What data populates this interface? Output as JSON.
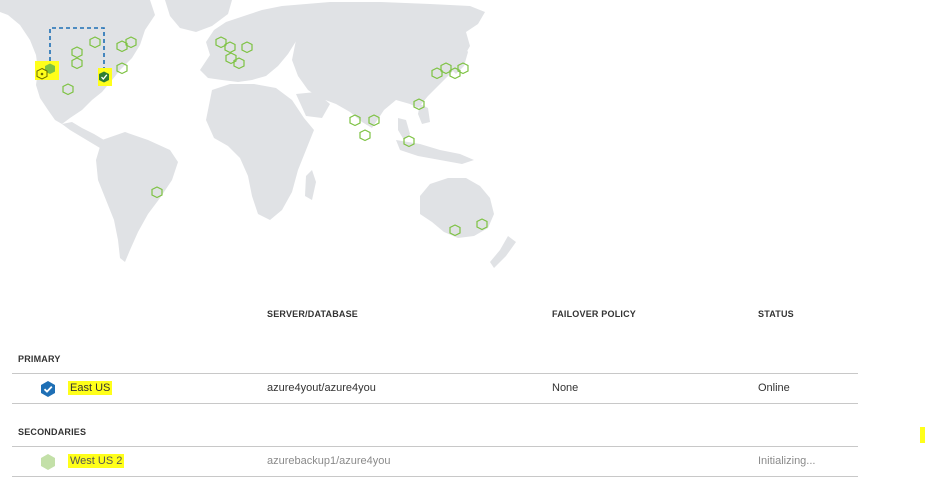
{
  "columns": {
    "server_database": "SERVER/DATABASE",
    "failover_policy": "FAILOVER POLICY",
    "status": "STATUS"
  },
  "primary": {
    "section_label": "PRIMARY",
    "region": "East US",
    "server_database": "azure4yout/azure4you",
    "failover_policy": "None",
    "status": "Online"
  },
  "secondaries": {
    "section_label": "SECONDARIES",
    "region": "West US 2",
    "server_database": "azurebackup1/azure4you",
    "failover_policy": "",
    "status": "Initializing..."
  },
  "colors": {
    "land": "#e0e2e5",
    "region_marker": "#7dc242",
    "primary_icon": "#1e6fb5",
    "secondary_icon": "#c3e0a8",
    "highlight": "#ffff1a",
    "link_line": "#1e6fb5"
  },
  "icons": {
    "primary_region": "checkmark-hexagon-icon",
    "secondary_region": "hexagon-icon",
    "region_marker": "hexagon-outline-icon"
  }
}
